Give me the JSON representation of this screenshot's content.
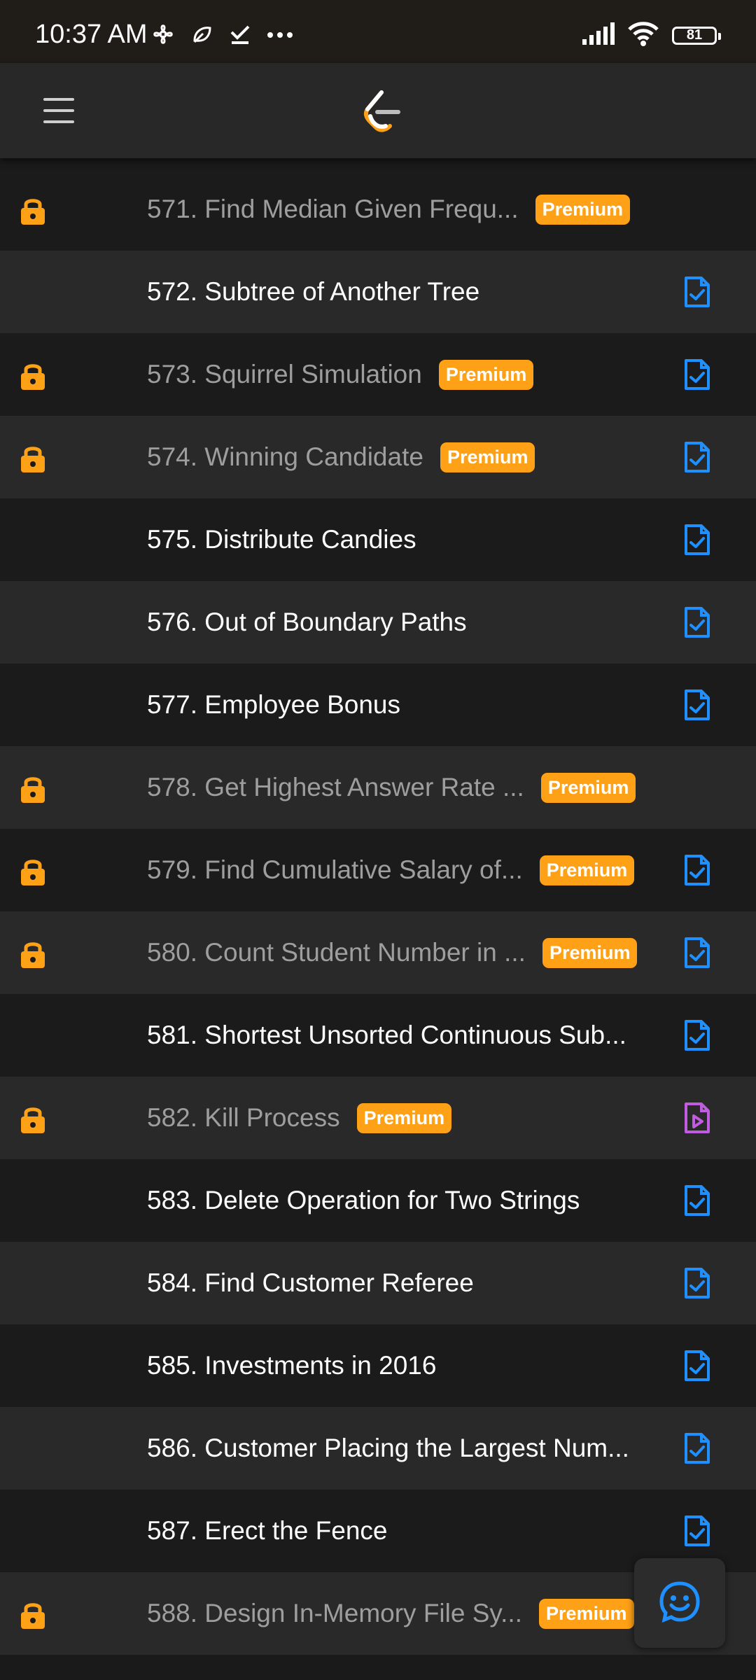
{
  "status_bar": {
    "time": "10:37 AM",
    "battery": "81",
    "left_icons": [
      "fan-icon",
      "leaf-icon",
      "check-icon",
      "more-dots-icon"
    ],
    "right_icons": [
      "signal-icon",
      "wifi-icon",
      "battery-icon"
    ]
  },
  "app_bar": {
    "menu_icon": "hamburger-menu-icon",
    "logo_icon": "leetcode-logo-icon"
  },
  "colors": {
    "premium_badge": "#ffa116",
    "lock": "#ffa116",
    "solution_icon": "#1e90ff",
    "video_icon": "#c05ce0",
    "row_dark": "#1b1b1b",
    "row_light": "#292929"
  },
  "problems": [
    {
      "title": "571. Find Median Given Frequ...",
      "locked": true,
      "premium": "Premium",
      "icon": "none"
    },
    {
      "title": "572. Subtree of Another Tree",
      "locked": false,
      "premium": "",
      "icon": "solution-doc-icon"
    },
    {
      "title": "573. Squirrel Simulation",
      "locked": true,
      "premium": "Premium",
      "icon": "solution-doc-icon"
    },
    {
      "title": "574. Winning Candidate",
      "locked": true,
      "premium": "Premium",
      "icon": "solution-doc-icon"
    },
    {
      "title": "575. Distribute Candies",
      "locked": false,
      "premium": "",
      "icon": "solution-doc-icon"
    },
    {
      "title": "576. Out of Boundary Paths",
      "locked": false,
      "premium": "",
      "icon": "solution-doc-icon"
    },
    {
      "title": "577. Employee Bonus",
      "locked": false,
      "premium": "",
      "icon": "solution-doc-icon"
    },
    {
      "title": "578. Get Highest Answer Rate ...",
      "locked": true,
      "premium": "Premium",
      "icon": "none"
    },
    {
      "title": "579. Find Cumulative Salary of...",
      "locked": true,
      "premium": "Premium",
      "icon": "solution-doc-icon"
    },
    {
      "title": "580. Count Student Number in ...",
      "locked": true,
      "premium": "Premium",
      "icon": "solution-doc-icon"
    },
    {
      "title": "581. Shortest Unsorted Continuous Sub...",
      "locked": false,
      "premium": "",
      "icon": "solution-doc-icon"
    },
    {
      "title": "582. Kill Process",
      "locked": true,
      "premium": "Premium",
      "icon": "video-doc-icon"
    },
    {
      "title": "583. Delete Operation for Two Strings",
      "locked": false,
      "premium": "",
      "icon": "solution-doc-icon"
    },
    {
      "title": "584. Find Customer Referee",
      "locked": false,
      "premium": "",
      "icon": "solution-doc-icon"
    },
    {
      "title": "585. Investments in 2016",
      "locked": false,
      "premium": "",
      "icon": "solution-doc-icon"
    },
    {
      "title": "586. Customer Placing the Largest Num...",
      "locked": false,
      "premium": "",
      "icon": "solution-doc-icon"
    },
    {
      "title": "587. Erect the Fence",
      "locked": false,
      "premium": "",
      "icon": "solution-doc-icon"
    },
    {
      "title": "588. Design In-Memory File Sy...",
      "locked": true,
      "premium": "Premium",
      "icon": "none"
    }
  ],
  "fab": {
    "icon": "feedback-smiley-icon"
  }
}
